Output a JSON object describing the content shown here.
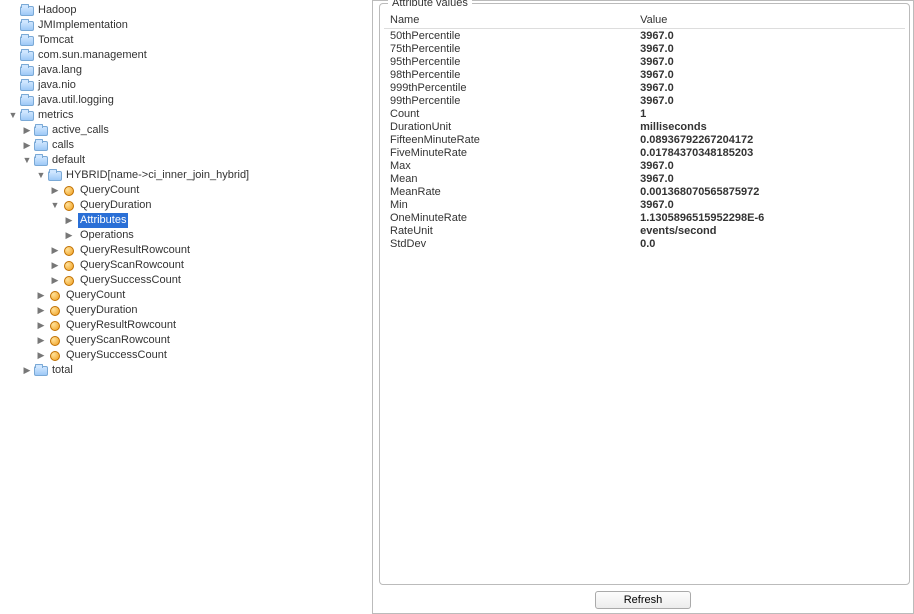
{
  "panel": {
    "legend": "Attribute values",
    "refresh_label": "Refresh",
    "columns": {
      "name": "Name",
      "value": "Value"
    }
  },
  "tree": {
    "roots": [
      {
        "label": "Hadoop",
        "icon": "folder",
        "expanded": false
      },
      {
        "label": "JMImplementation",
        "icon": "folder",
        "expanded": false
      },
      {
        "label": "Tomcat",
        "icon": "folder",
        "expanded": false
      },
      {
        "label": "com.sun.management",
        "icon": "folder",
        "expanded": false
      },
      {
        "label": "java.lang",
        "icon": "folder",
        "expanded": false
      },
      {
        "label": "java.nio",
        "icon": "folder",
        "expanded": false
      },
      {
        "label": "java.util.logging",
        "icon": "folder",
        "expanded": false
      },
      {
        "label": "metrics",
        "icon": "folder",
        "expanded": true,
        "children": [
          {
            "label": "active_calls",
            "icon": "folder",
            "expanded": false,
            "arrow": true
          },
          {
            "label": "calls",
            "icon": "folder",
            "expanded": false,
            "arrow": true
          },
          {
            "label": "default",
            "icon": "folder",
            "expanded": true,
            "children": [
              {
                "label": "HYBRID[name->ci_inner_join_hybrid]",
                "icon": "folder",
                "expanded": true,
                "children": [
                  {
                    "label": "QueryCount",
                    "icon": "bean",
                    "arrow": true
                  },
                  {
                    "label": "QueryDuration",
                    "icon": "bean",
                    "expanded": true,
                    "children": [
                      {
                        "label": "Attributes",
                        "icon": "none",
                        "arrow": true,
                        "selected": true
                      },
                      {
                        "label": "Operations",
                        "icon": "none",
                        "arrow": true
                      }
                    ]
                  },
                  {
                    "label": "QueryResultRowcount",
                    "icon": "bean",
                    "arrow": true
                  },
                  {
                    "label": "QueryScanRowcount",
                    "icon": "bean",
                    "arrow": true
                  },
                  {
                    "label": "QuerySuccessCount",
                    "icon": "bean",
                    "arrow": true
                  }
                ]
              },
              {
                "label": "QueryCount",
                "icon": "bean",
                "arrow": true
              },
              {
                "label": "QueryDuration",
                "icon": "bean",
                "arrow": true
              },
              {
                "label": "QueryResultRowcount",
                "icon": "bean",
                "arrow": true
              },
              {
                "label": "QueryScanRowcount",
                "icon": "bean",
                "arrow": true
              },
              {
                "label": "QuerySuccessCount",
                "icon": "bean",
                "arrow": true
              }
            ]
          },
          {
            "label": "total",
            "icon": "folder",
            "expanded": false,
            "arrow": true
          }
        ]
      }
    ]
  },
  "attributes": [
    {
      "name": "50thPercentile",
      "value": "3967.0"
    },
    {
      "name": "75thPercentile",
      "value": "3967.0"
    },
    {
      "name": "95thPercentile",
      "value": "3967.0"
    },
    {
      "name": "98thPercentile",
      "value": "3967.0"
    },
    {
      "name": "999thPercentile",
      "value": "3967.0"
    },
    {
      "name": "99thPercentile",
      "value": "3967.0"
    },
    {
      "name": "Count",
      "value": "1"
    },
    {
      "name": "DurationUnit",
      "value": "milliseconds"
    },
    {
      "name": "FifteenMinuteRate",
      "value": "0.08936792267204172"
    },
    {
      "name": "FiveMinuteRate",
      "value": "0.01784370348185203"
    },
    {
      "name": "Max",
      "value": "3967.0"
    },
    {
      "name": "Mean",
      "value": "3967.0"
    },
    {
      "name": "MeanRate",
      "value": "0.001368070565875972"
    },
    {
      "name": "Min",
      "value": "3967.0"
    },
    {
      "name": "OneMinuteRate",
      "value": "1.1305896515952298E-6"
    },
    {
      "name": "RateUnit",
      "value": "events/second"
    },
    {
      "name": "StdDev",
      "value": "0.0"
    }
  ]
}
